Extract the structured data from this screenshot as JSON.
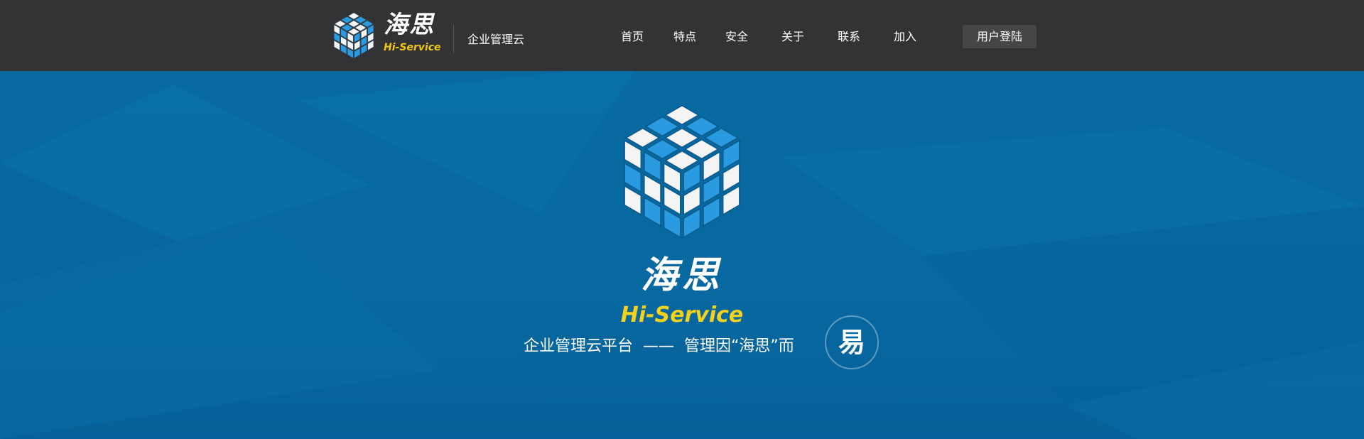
{
  "header": {
    "logo_cn": "海思",
    "logo_en": "Hi-Service",
    "subtitle": "企业管理云",
    "nav": [
      {
        "label": "首页"
      },
      {
        "label": "特点"
      },
      {
        "label": "安全"
      },
      {
        "label": "关于"
      },
      {
        "label": "联系"
      },
      {
        "label": "加入"
      }
    ],
    "login_label": "用户登陆"
  },
  "hero": {
    "title_cn": "海思",
    "title_en": "Hi-Service",
    "tagline_left": "企业管理云平台",
    "tagline_dash": "——",
    "tagline_right": "管理因“海思”而",
    "badge": "易"
  },
  "colors": {
    "topbar": "#333335",
    "hero_bg": "#0a6ca3",
    "accent_yellow": "#f2c811",
    "cube_blue": "#2a9be0",
    "cube_white": "#f4f4f4"
  },
  "icons": {
    "logo": "rubiks-cube-icon",
    "hero": "rubiks-cube-icon"
  }
}
